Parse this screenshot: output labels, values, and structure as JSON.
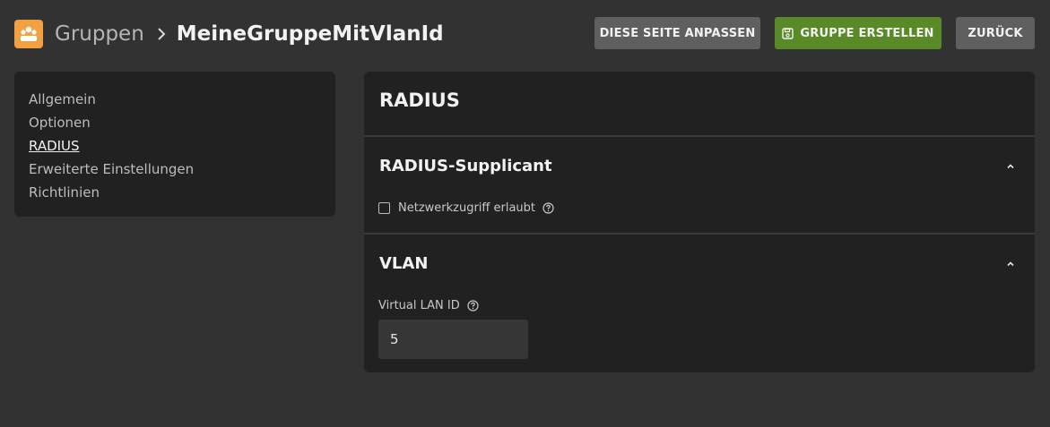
{
  "header": {
    "app_icon": "group-icon",
    "breadcrumb_parent": "Gruppen",
    "breadcrumb_current": "MeineGruppeMitVlanId"
  },
  "toolbar": {
    "customize_label": "DIESE SEITE ANPASSEN",
    "create_label": "GRUPPE ERSTELLEN",
    "back_label": "ZURÜCK"
  },
  "nav": {
    "items": [
      {
        "label": "Allgemein"
      },
      {
        "label": "Optionen"
      },
      {
        "label": "RADIUS",
        "active": true
      },
      {
        "label": "Erweiterte Einstellungen"
      },
      {
        "label": "Richtlinien"
      }
    ]
  },
  "panel": {
    "title": "RADIUS",
    "supplicant": {
      "title": "RADIUS-Supplicant",
      "network_access_label": "Netzwerkzugriff erlaubt",
      "network_access_checked": false
    },
    "vlan": {
      "title": "VLAN",
      "field_label": "Virtual LAN ID",
      "field_value": "5"
    }
  },
  "colors": {
    "accent_green": "#5a8a28",
    "app_icon_orange": "#f2a142",
    "background": "#323232",
    "card": "#212121"
  }
}
